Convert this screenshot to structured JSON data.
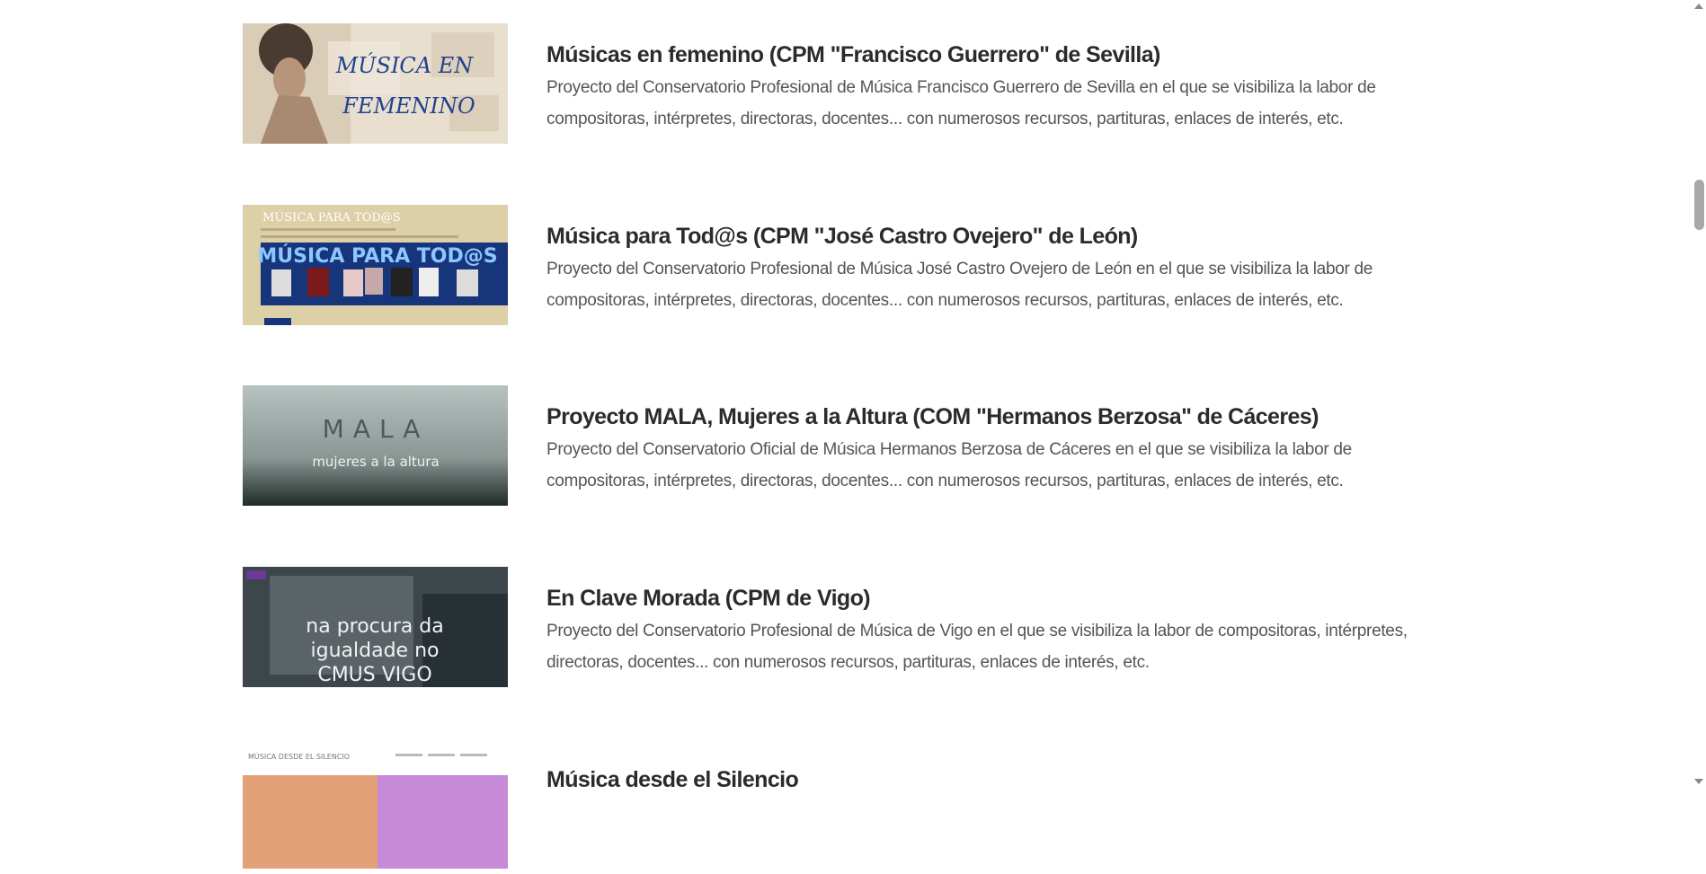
{
  "items": [
    {
      "title": "Músicas en femenino (CPM \"Francisco Guerrero\" de Sevilla)",
      "description": "Proyecto del Conservatorio Profesional de Música Francisco Guerrero de Sevilla en el que se visibiliza la labor de compositoras, intérpretes, directoras, docentes... con numerosos recursos, partituras, enlaces de interés, etc.",
      "thumb_lines": [
        "MÚSICA EN",
        "FEMENINO"
      ]
    },
    {
      "title": "Música para Tod@s (CPM \"José Castro Ovejero\" de León)",
      "description": "Proyecto del Conservatorio Profesional de Música José Castro Ovejero de León en el que se visibiliza la labor de compositoras, intérpretes, directoras, docentes... con numerosos recursos, partituras, enlaces de interés, etc.",
      "thumb_lines": [
        "MÚSICA PARA TOD@S",
        "MÚSICA PARA TOD@S"
      ]
    },
    {
      "title": "Proyecto MALA, Mujeres a la Altura (COM \"Hermanos Berzosa\" de Cáceres)",
      "description": "Proyecto del Conservatorio Oficial de Música Hermanos Berzosa de Cáceres en el que se visibiliza la labor de compositoras, intérpretes, directoras, docentes... con numerosos recursos, partituras, enlaces de interés, etc.",
      "thumb_lines": [
        "MALA",
        "mujeres a la altura"
      ]
    },
    {
      "title": "En Clave Morada (CPM de Vigo)",
      "description": "Proyecto del Conservatorio Profesional de Música de Vigo en el que se visibiliza la labor de compositoras, intérpretes, directoras, docentes... con numerosos recursos, partituras, enlaces de interés, etc.",
      "thumb_lines": [
        "na procura da",
        "igualdade no",
        "CMUS VIGO"
      ]
    },
    {
      "title": "Música desde el Silencio",
      "description": "",
      "thumb_lines": [
        "MÚSICA DESDE EL SILENCIO"
      ]
    }
  ]
}
